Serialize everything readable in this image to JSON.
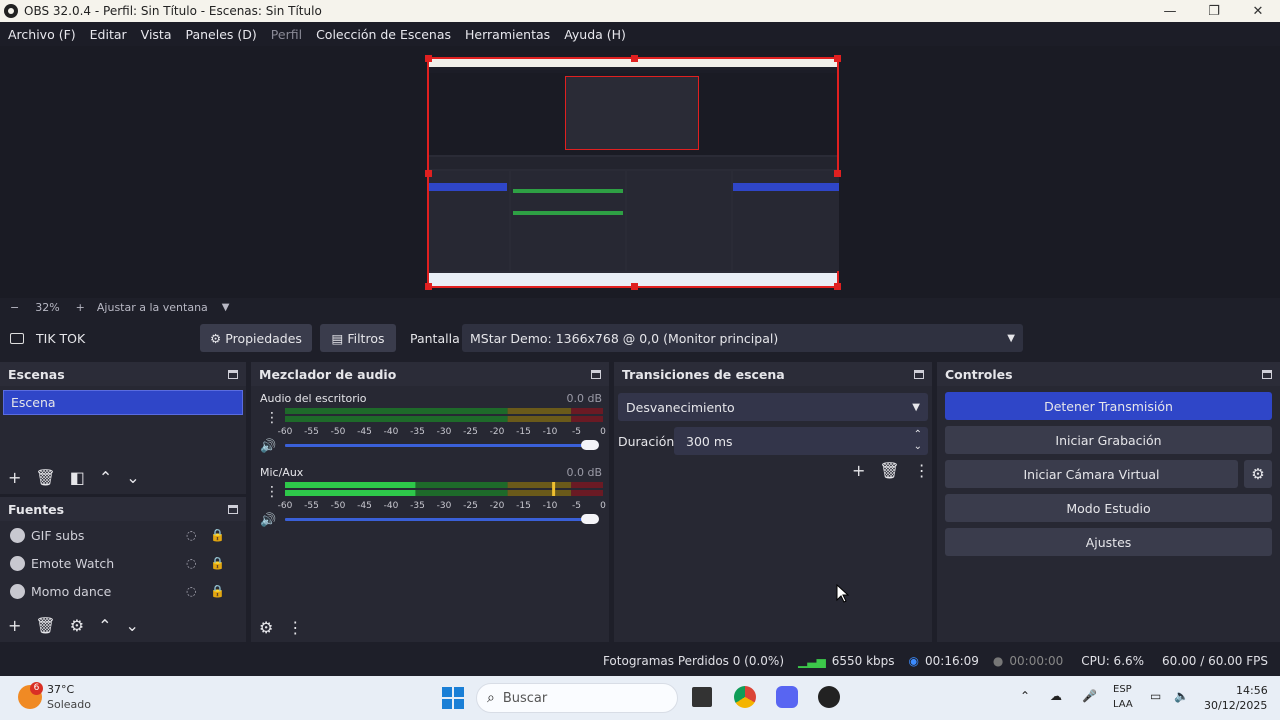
{
  "window": {
    "title": "OBS 32.0.4 - Perfil: Sin Título - Escenas: Sin Título",
    "minimize": "—",
    "maximize": "❐",
    "close": "✕"
  },
  "menu": [
    "Archivo (F)",
    "Editar",
    "Vista",
    "Paneles (D)",
    "Perfil",
    "Colección de Escenas",
    "Herramientas",
    "Ayuda (H)"
  ],
  "zoom": {
    "minus": "−",
    "value": "32%",
    "plus": "+",
    "fit": "Ajustar a la ventana"
  },
  "sourcebar": {
    "source_name": "TIK TOK",
    "properties": "Propiedades",
    "filters": "Filtros",
    "display_label": "Pantalla",
    "display_value": "MStar Demo: 1366x768 @ 0,0 (Monitor principal)"
  },
  "scenes": {
    "title": "Escenas",
    "items": [
      "Escena"
    ]
  },
  "sources": {
    "title": "Fuentes",
    "items": [
      "GIF subs",
      "Emote Watch",
      "Momo dance"
    ]
  },
  "mixer": {
    "title": "Mezclador de audio",
    "tracks": [
      {
        "name": "Audio del escritorio",
        "db": "0.0 dB",
        "level": 1.0,
        "volume": 1.0
      },
      {
        "name": "Mic/Aux",
        "db": "0.0 dB",
        "level": 0.41,
        "volume": 1.0
      }
    ],
    "ticks": [
      "-60",
      "-55",
      "-50",
      "-45",
      "-40",
      "-35",
      "-30",
      "-25",
      "-20",
      "-15",
      "-10",
      "-5",
      "0"
    ]
  },
  "transitions": {
    "title": "Transiciones de escena",
    "selected": "Desvanecimiento",
    "duration_label": "Duración",
    "duration_value": "300 ms"
  },
  "controls": {
    "title": "Controles",
    "stop_stream": "Detener Transmisión",
    "start_recording": "Iniciar Grabación",
    "virtual_cam": "Iniciar Cámara Virtual",
    "studio_mode": "Modo Estudio",
    "settings": "Ajustes"
  },
  "status": {
    "dropped": "Fotogramas Perdidos 0 (0.0%)",
    "bitrate": "6550 kbps",
    "stream_time": "00:16:09",
    "rec_time": "00:00:00",
    "cpu": "CPU: 6.6%",
    "fps": "60.00 / 60.00 FPS"
  },
  "taskbar": {
    "weather_badge": "6",
    "temp": "37°C",
    "condition": "Soleado",
    "search": "Buscar",
    "lang1": "ESP",
    "lang2": "LAA",
    "time": "14:56",
    "date": "30/12/2025"
  },
  "colors": {
    "accent": "#2f46c8",
    "panel": "#272833",
    "bg": "#1e1f29",
    "live": "#e02020"
  }
}
